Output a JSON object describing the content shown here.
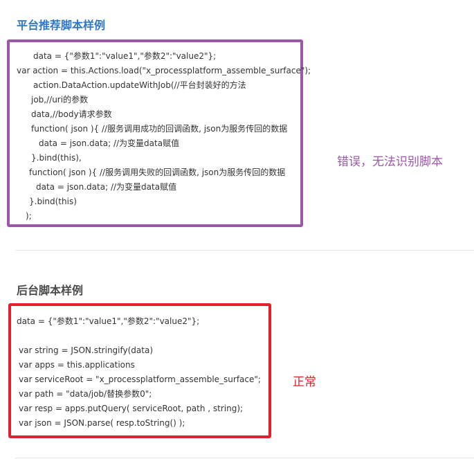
{
  "platform_section": {
    "title": "平台推荐脚本样例",
    "lines": [
      "data = {\"参数1\":\"value1\",\"参数2\":\"value2\"};",
      "var action = this.Actions.load(\"x_processplatform_assemble_surface\");",
      "action.DataAction.updateWithJob(//平台封装好的方法",
      "job,//uri的参数",
      "data,//body请求参数",
      "function( json ){ //服务调用成功的回调函数, json为服务传回的数据",
      "data = json.data; //为变量data赋值",
      "}.bind(this),",
      "function( json ){ //服务调用失败的回调函数, json为服务传回的数据",
      "data = json.data; //为变量data赋值",
      "}.bind(this)",
      ");"
    ],
    "annotation": "错误，无法识别脚本"
  },
  "backend_section": {
    "title": "后台脚本样例",
    "lines": [
      "data = {\"参数1\":\"value1\",\"参数2\":\"value2\"};",
      "",
      "var string = JSON.stringify(data)",
      "var apps = this.applications",
      "var serviceRoot = \"x_processplatform_assemble_surface\";",
      "var path = \"data/job/替换参数0\";",
      "var resp = apps.putQuery( serviceRoot, path , string);",
      "var json = JSON.parse( resp.toString() );"
    ],
    "annotation": "正常"
  },
  "colors": {
    "title_blue": "#2d78c8",
    "highlight_purple": "#9b57a8",
    "highlight_red": "#e3202c"
  }
}
